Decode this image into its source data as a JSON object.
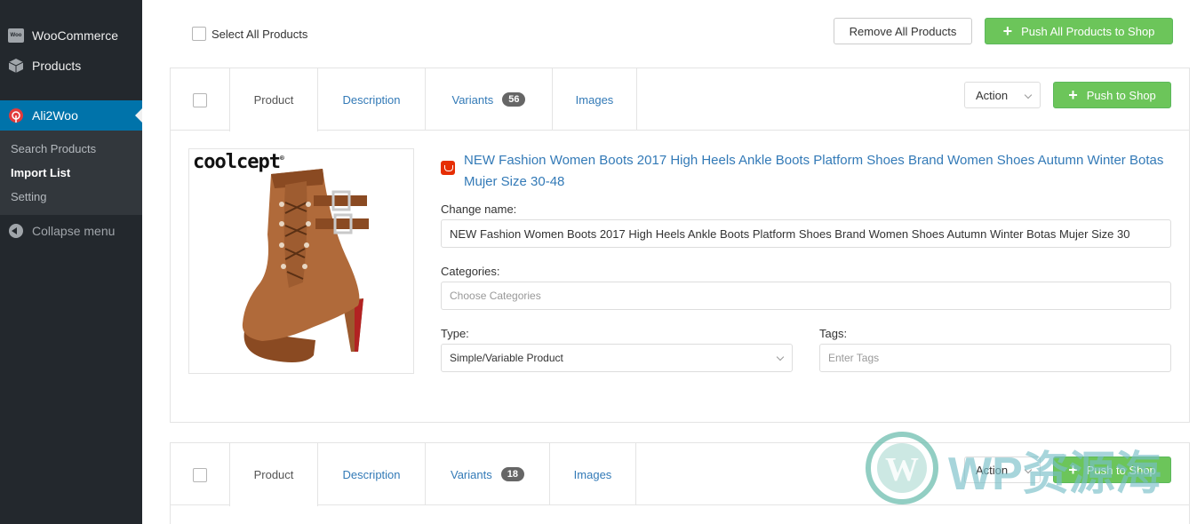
{
  "sidebar": {
    "woocommerce": "WooCommerce",
    "woo_badge": "Woo",
    "products": "Products",
    "ali2woo": "Ali2Woo",
    "submenu": [
      "Search Products",
      "Import List",
      "Setting"
    ],
    "collapse": "Collapse menu"
  },
  "toolbar": {
    "select_all": "Select All Products",
    "remove_all": "Remove All Products",
    "push_all": "Push All Products to Shop"
  },
  "cards": [
    {
      "tabs": [
        "Product",
        "Description",
        "Variants",
        "Images"
      ],
      "variants_count": "56",
      "action_label": "Action",
      "push_label": "Push to Shop",
      "brand": "coolcept",
      "title": "NEW Fashion Women Boots 2017 High Heels Ankle Boots Platform Shoes Brand Women Shoes Autumn Winter Botas Mujer Size 30-48",
      "change_name_label": "Change name:",
      "change_name_value": "NEW Fashion Women Boots 2017 High Heels Ankle Boots Platform Shoes Brand Women Shoes Autumn Winter Botas Mujer Size 30",
      "categories_label": "Categories:",
      "categories_placeholder": "Choose Categories",
      "type_label": "Type:",
      "type_value": "Simple/Variable Product",
      "tags_label": "Tags:",
      "tags_placeholder": "Enter Tags"
    },
    {
      "tabs": [
        "Product",
        "Description",
        "Variants",
        "Images"
      ],
      "variants_count": "18",
      "action_label": "Action",
      "push_label": "Push to Shop"
    }
  ],
  "watermark": "WP资源海",
  "colors": {
    "accent_green": "#6cc55a",
    "link_blue": "#337ab7",
    "admin_blue": "#0073aa",
    "sidebar_bg": "#23282d"
  }
}
